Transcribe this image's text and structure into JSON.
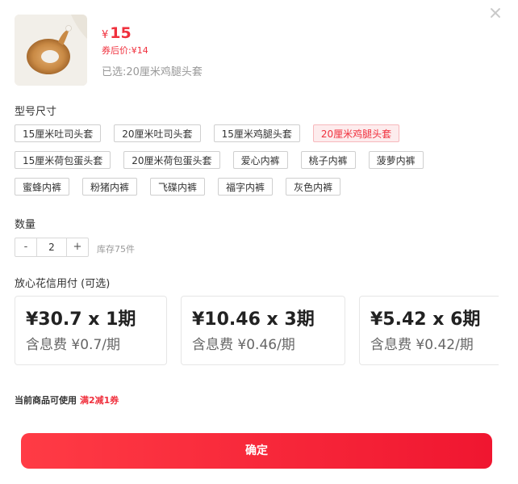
{
  "product": {
    "price_symbol": "¥",
    "price": "15",
    "coupon_price": "券后价:¥14",
    "selected_text": "已选:20厘米鸡腿头套"
  },
  "spec": {
    "title": "型号尺寸",
    "rows": [
      [
        "15厘米吐司头套",
        "20厘米吐司头套",
        "15厘米鸡腿头套",
        "20厘米鸡腿头套"
      ],
      [
        "15厘米荷包蛋头套",
        "20厘米荷包蛋头套",
        "爱心内裤",
        "桃子内裤",
        "菠萝内裤"
      ],
      [
        "蜜蜂内裤",
        "粉猪内裤",
        "飞碟内裤",
        "福字内裤",
        "灰色内裤"
      ]
    ],
    "selected": "20厘米鸡腿头套"
  },
  "quantity": {
    "title": "数量",
    "minus": "-",
    "value": "2",
    "plus": "+",
    "stock": "库存75件"
  },
  "credit": {
    "title": "放心花信用付 (可选)",
    "options": [
      {
        "main": "¥30.7 x 1期",
        "sub": "含息费 ¥0.7/期"
      },
      {
        "main": "¥10.46 x 3期",
        "sub": "含息费 ¥0.46/期"
      },
      {
        "main": "¥5.42 x 6期",
        "sub": "含息费 ¥0.42/期"
      }
    ]
  },
  "coupon_note": {
    "text": "当前商品可使用",
    "highlight": "满2减1券"
  },
  "confirm_label": "确定",
  "colors": {
    "accent": "#f0303d",
    "gradient_start": "#ff3b45",
    "gradient_end": "#f01630"
  },
  "icons": [
    "close-icon",
    "product-image"
  ]
}
